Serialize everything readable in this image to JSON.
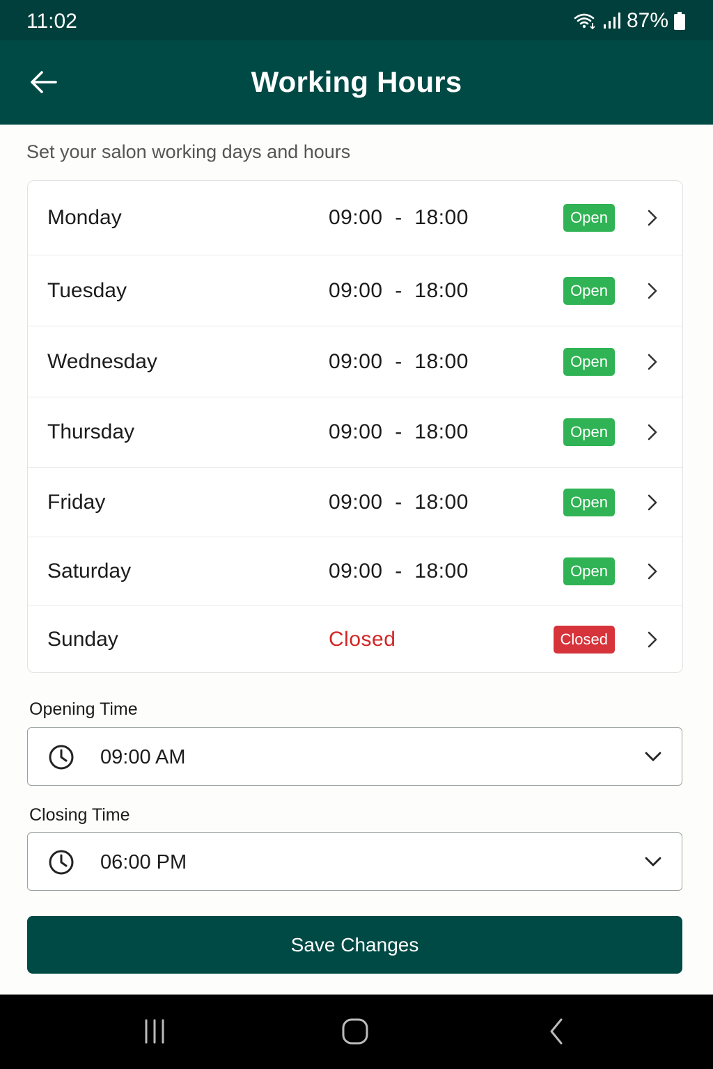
{
  "status": {
    "time": "11:02",
    "battery": "87%"
  },
  "header": {
    "title": "Working Hours"
  },
  "subtitle": "Set your salon working days and hours",
  "days": [
    {
      "name": "Monday",
      "hours": "09:00  -  18:00",
      "status": "Open"
    },
    {
      "name": "Tuesday",
      "hours": "09:00  -  18:00",
      "status": "Open"
    },
    {
      "name": "Wednesday",
      "hours": "09:00  -  18:00",
      "status": "Open"
    },
    {
      "name": "Thursday",
      "hours": "09:00  -  18:00",
      "status": "Open"
    },
    {
      "name": "Friday",
      "hours": "09:00  -  18:00",
      "status": "Open"
    },
    {
      "name": "Saturday",
      "hours": "09:00  -  18:00",
      "status": "Open"
    },
    {
      "name": "Sunday",
      "hours": "Closed",
      "status": "Closed"
    }
  ],
  "opening": {
    "label": "Opening Time",
    "value": "09:00 AM"
  },
  "closing": {
    "label": "Closing Time",
    "value": "06:00 PM"
  },
  "save_label": "Save Changes",
  "colors": {
    "primary": "#004a45",
    "open": "#2fb354",
    "closed": "#d7333a",
    "closed_text": "#d32626"
  },
  "icons": [
    "back-arrow-icon",
    "wifi-icon",
    "signal-icon",
    "battery-icon",
    "chevron-right-icon",
    "clock-icon",
    "chevron-down-icon",
    "recents-icon",
    "home-icon",
    "back-nav-icon"
  ]
}
